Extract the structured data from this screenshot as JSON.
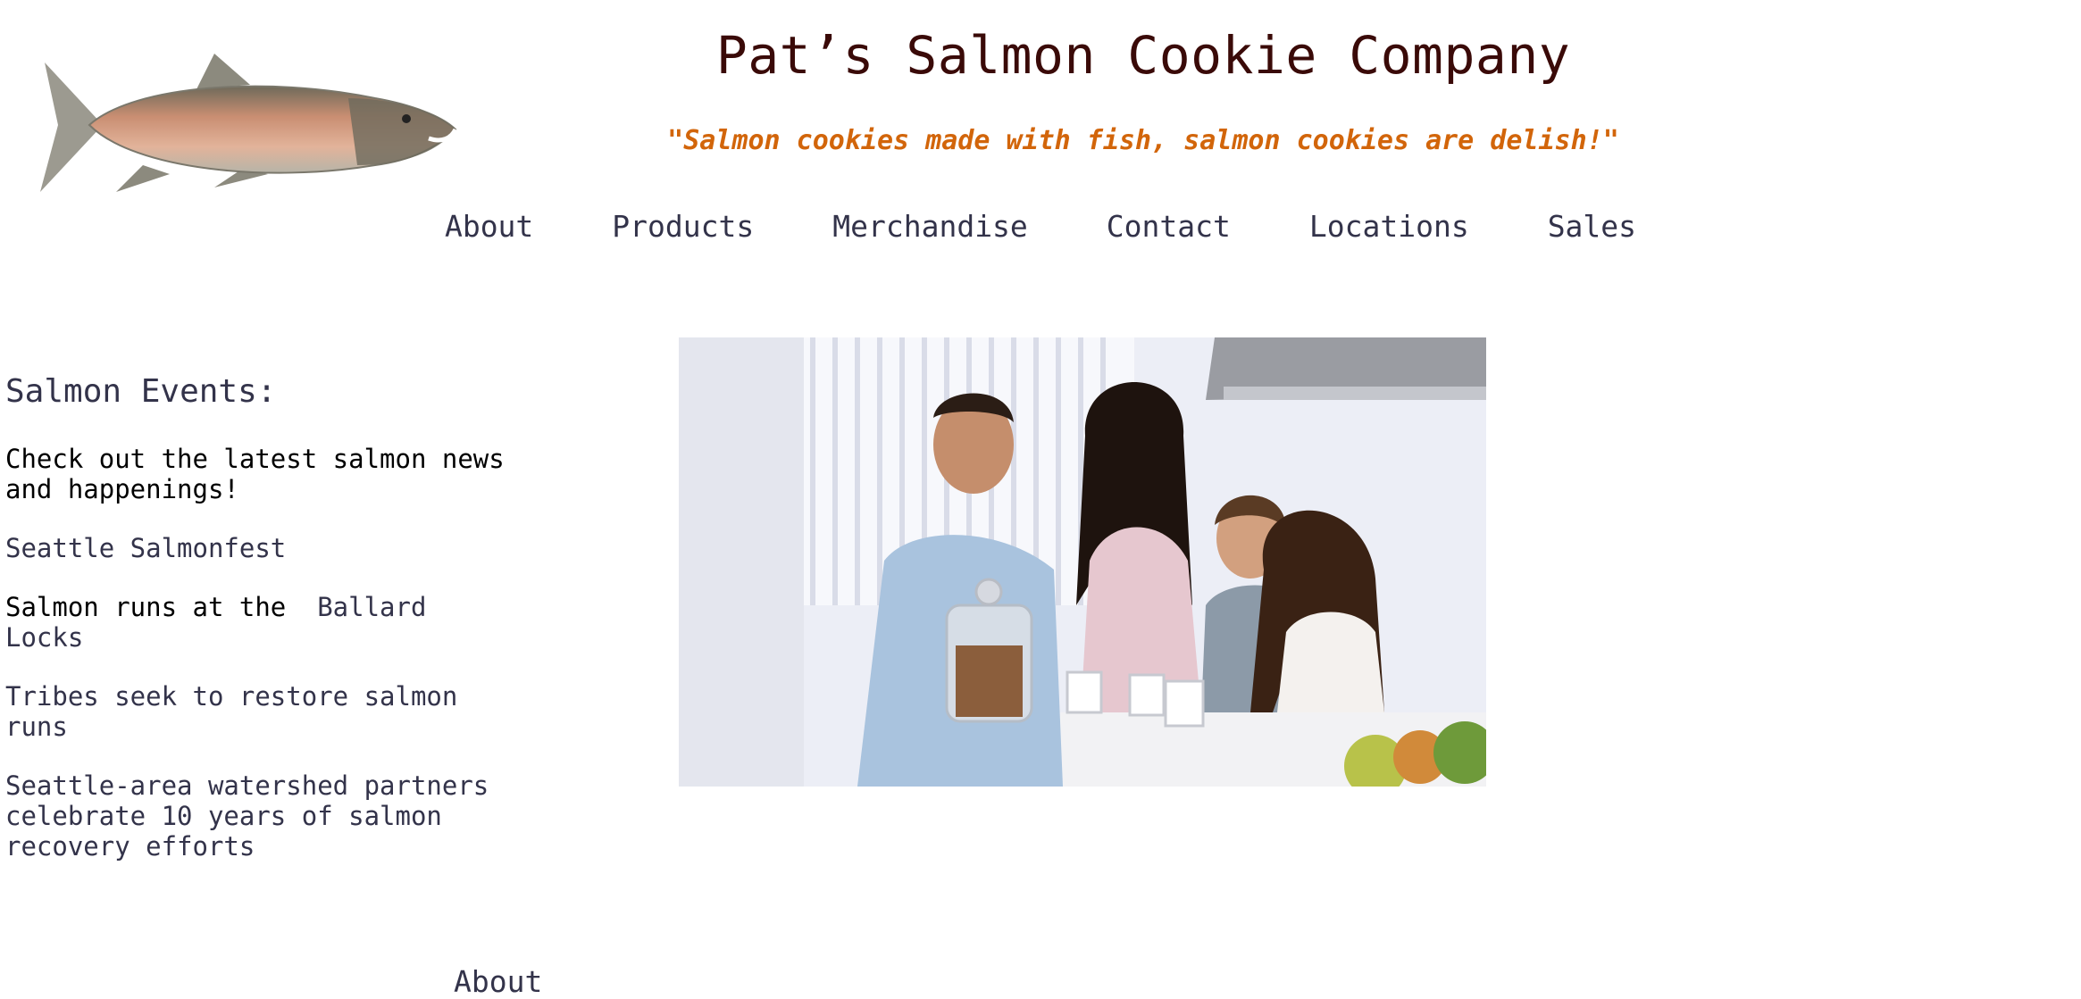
{
  "header": {
    "title": "Pat’s Salmon Cookie Company",
    "tagline": "\"Salmon cookies made with fish, salmon cookies are delish!\"",
    "logo_icon": "salmon-fish-icon"
  },
  "nav": {
    "items": [
      {
        "label": "About"
      },
      {
        "label": "Products"
      },
      {
        "label": "Merchandise"
      },
      {
        "label": "Contact"
      },
      {
        "label": "Locations"
      },
      {
        "label": "Sales"
      }
    ]
  },
  "sidebar": {
    "heading": "Salmon Events:",
    "intro": "Check out the latest salmon news and happenings!",
    "link_salmonfest": "Seattle Salmonfest",
    "runs_prefix": "Salmon runs at the ",
    "link_ballard": "Ballard Locks",
    "link_tribes": "Tribes seek to restore salmon runs",
    "link_watershed": "Seattle-area watershed partners celebrate 10 years of salmon recovery efforts"
  },
  "hero": {
    "image": "family-with-cookies-photo"
  },
  "bottom": {
    "heading": "About"
  },
  "colors": {
    "title": "#3a0a08",
    "tagline": "#d2650a",
    "nav_link": "#33334a"
  }
}
